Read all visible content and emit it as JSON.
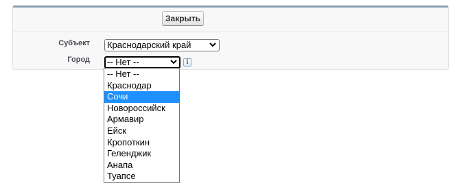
{
  "form": {
    "close_button": "Закрыть",
    "subject_label": "Субъект",
    "subject_value": "Краснодарский край",
    "city_label": "Город",
    "city_value": "-- Нет --",
    "info_icon_text": "i"
  },
  "city_dropdown": {
    "highlighted": "Сочи",
    "options": [
      "-- Нет --",
      "Краснодар",
      "Сочи",
      "Новороссийск",
      "Армавир",
      "Ейск",
      "Кропоткин",
      "Геленджик",
      "Анапа",
      "Туапсе"
    ]
  },
  "colors": {
    "panel_top_border": "#8a9eb2",
    "highlight": "#1e90ff"
  }
}
